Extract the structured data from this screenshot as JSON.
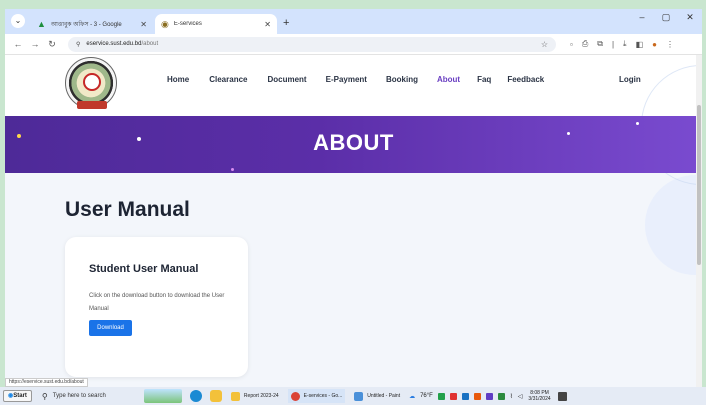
{
  "browser": {
    "tabs": [
      {
        "label": "আত্তাবুক অফিস - 3 - Google",
        "icon": "drive-icon",
        "active": false
      },
      {
        "label": "E-services",
        "icon": "site-favicon",
        "active": true
      }
    ],
    "new_tab_label": "+",
    "window_controls": [
      "–",
      "▢",
      "✕"
    ],
    "url_host": "eservice.sust.edu.bd",
    "url_path": "/about",
    "status_url": "https://eservice.sust.edu.bd/about"
  },
  "site": {
    "nav": [
      "Home",
      "Clearance",
      "Document",
      "E-Payment",
      "Booking",
      "About",
      "Faq",
      "Feedback"
    ],
    "active_nav": "About",
    "login_label": "Login",
    "hero_title": "ABOUT",
    "section_title": "User Manual",
    "card": {
      "title": "Student User Manual",
      "description": "Click on the download button to download the User Manual",
      "button_label": "Download"
    },
    "colors": {
      "hero": "#5b2ea8",
      "button": "#1a73e8",
      "active_nav": "#6a3fc2"
    }
  },
  "taskbar": {
    "start_label": "Start",
    "search_placeholder": "Type here to search",
    "apps": [
      {
        "label": "Report 2023-24",
        "color": "#f3c13a"
      },
      {
        "label": "E-services - Go...",
        "color": "#db4437"
      },
      {
        "label": "Untitled - Paint",
        "color": "#4a90d9"
      }
    ],
    "weather": "76°F",
    "time": "8:08 PM",
    "date": "3/31/2024"
  }
}
